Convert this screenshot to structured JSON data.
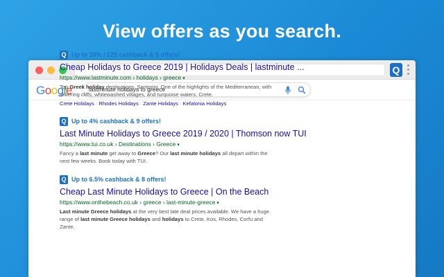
{
  "headline": "View offers as you search.",
  "browser": {
    "extension_icon": "Q",
    "google_logo": [
      "G",
      "o",
      "o",
      "g",
      "l",
      "e"
    ],
    "google_colors": [
      "#4285f4",
      "#ea4335",
      "#fbbc05",
      "#4285f4",
      "#34a853",
      "#ea4335"
    ],
    "search_query": "lastminute holidays to greece"
  },
  "results": [
    {
      "badge": "Q",
      "offer": "Up to 10% / £25 cashback & 5 offers!",
      "title": "Cheap Holidays to Greece 2019 | Holidays Deals | lastminute ...",
      "url": "https://www.lastminute.com › holidays › greece",
      "snippet_html": "Top <b>Greek holiday</b> destinations. Santorini. One of the highlights of the Mediterranean, with towering cliffs, whitewashed villages, and turquoise waters. Crete.",
      "sitelinks": [
        "Crete Holidays",
        "Rhodes Holidays",
        "Zante Holidays",
        "Kefalonia Holidays"
      ]
    },
    {
      "badge": "Q",
      "offer": "Up to 4% cashback & 9 offers!",
      "title": "Last Minute Holidays to Greece 2019 / 2020 | Thomson now TUI",
      "url": "https://www.tui.co.uk › Destinations › Greece",
      "snippet_html": "Fancy a <b>last minute</b> get away to <b>Greece</b>? Our <b>last minute holidays</b> all depart within the next few weeks. Book today with TUI.",
      "sitelinks": []
    },
    {
      "badge": "Q",
      "offer": "Up to 6.5% cashback & 8 offers!",
      "title": "Cheap Last Minute Holidays to Greece | On the Beach",
      "url": "https://www.onthebeach.co.uk › greece › last-minute-greece",
      "snippet_html": "<b>Last minute Greece holidays</b> at the very best late deal prices available. We have a huge range of <b>last minute Greece holidays</b> and <b>holidays</b> to Crete, Kos, Rhodes, Corfu and Zante.",
      "sitelinks": []
    }
  ],
  "caret_glyph": "▾",
  "sitelink_separator": "·"
}
